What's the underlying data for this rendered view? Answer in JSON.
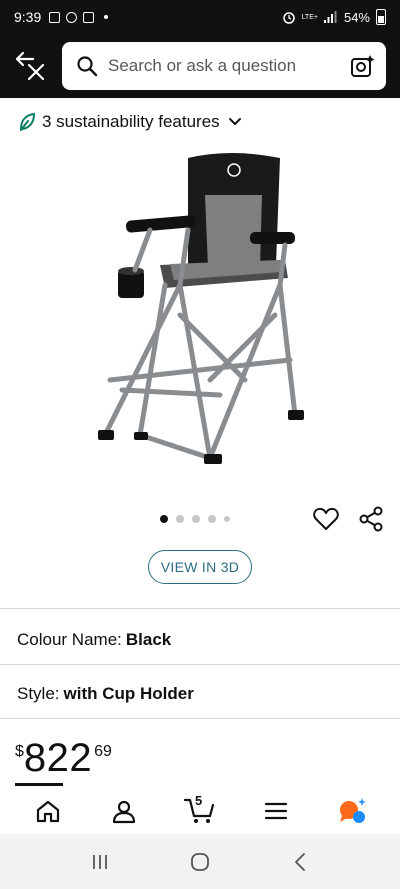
{
  "status_bar": {
    "time": "9:39",
    "network": "LTE+",
    "battery": "54%"
  },
  "search": {
    "placeholder": "Search or ask a question"
  },
  "sustainability": {
    "label": "3 sustainability features"
  },
  "carousel": {
    "image_count": 5,
    "active_index": 0
  },
  "view3d": {
    "label": "VIEW IN 3D"
  },
  "attributes": {
    "colour_key": "Colour Name:",
    "colour_value": "Black",
    "style_key": "Style:",
    "style_value": "with Cup Holder"
  },
  "price": {
    "currency": "$",
    "whole": "822",
    "fraction": "69"
  },
  "bottom_nav": {
    "cart_count": "5"
  },
  "icons": {
    "back": "back-close-icon",
    "search": "search-icon",
    "lens": "camera-search-icon",
    "leaf": "leaf-icon",
    "wish": "heart-icon",
    "share": "share-icon",
    "home": "home-icon",
    "account": "person-icon",
    "cart": "cart-icon",
    "menu": "hamburger-icon",
    "assistant": "chat-assistant-icon"
  },
  "colors": {
    "header_bg": "#111111",
    "view3d_accent": "#2b6c84",
    "leaf": "#067d62",
    "assistant_orange": "#ff6a1a",
    "assistant_blue": "#1a8cff"
  }
}
